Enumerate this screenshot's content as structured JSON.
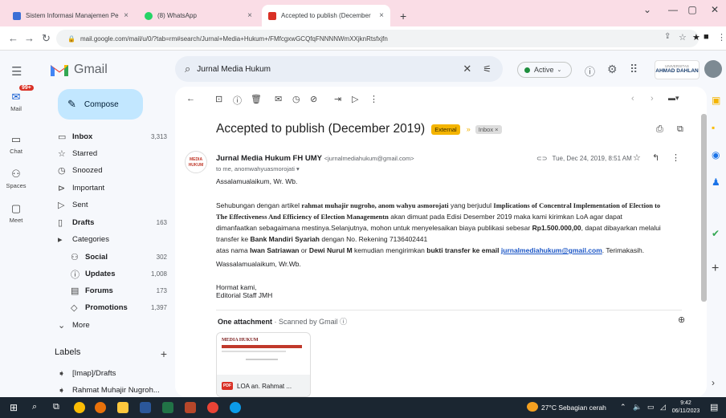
{
  "browser": {
    "tabs": [
      {
        "title": "Sistem Informasi Manajemen Pe",
        "close": "×",
        "color": "#3b6fd6"
      },
      {
        "title": "(8) WhatsApp",
        "close": "×",
        "color": "#25d366"
      },
      {
        "title": "Accepted to publish (December",
        "close": "×",
        "color": "#d93025"
      }
    ],
    "new_tab": "+",
    "window_controls": [
      "⌄",
      "—",
      "▢",
      "✕"
    ],
    "url": "mail.google.com/mail/u/0/?tab=rm#search/Jurnal+Media+Hukum+/FMfcgxwGCQfqFNNNNWmXXjknRtsfxjfn"
  },
  "header": {
    "brand": "Gmail",
    "search_value": "Jurnal Media Hukum",
    "status": "Active",
    "account_label": "AHMAD DAHLAN",
    "account_sub": "UNIVERSITAS"
  },
  "rail": {
    "items": [
      {
        "label": "Mail",
        "badge": "99+"
      },
      {
        "label": "Chat"
      },
      {
        "label": "Spaces"
      },
      {
        "label": "Meet"
      }
    ]
  },
  "sidebar": {
    "compose": "Compose",
    "items": [
      {
        "label": "Inbox",
        "count": "3,313",
        "icon": "▭",
        "bold": true
      },
      {
        "label": "Starred",
        "count": "",
        "icon": "☆",
        "bold": false
      },
      {
        "label": "Snoozed",
        "count": "",
        "icon": "◷",
        "bold": false
      },
      {
        "label": "Important",
        "count": "",
        "icon": "⊳",
        "bold": false
      },
      {
        "label": "Sent",
        "count": "",
        "icon": "▷",
        "bold": false
      },
      {
        "label": "Drafts",
        "count": "163",
        "icon": "▯",
        "bold": true
      },
      {
        "label": "Categories",
        "count": "",
        "icon": "▸",
        "bold": false
      },
      {
        "label": "Social",
        "count": "302",
        "icon": "⚇",
        "bold": true,
        "sub": true
      },
      {
        "label": "Updates",
        "count": "1,008",
        "icon": "ⓘ",
        "bold": true,
        "sub": true
      },
      {
        "label": "Forums",
        "count": "173",
        "icon": "▤",
        "bold": true,
        "sub": true
      },
      {
        "label": "Promotions",
        "count": "1,397",
        "icon": "◇",
        "bold": true,
        "sub": true
      },
      {
        "label": "More",
        "count": "",
        "icon": "⌄",
        "bold": false
      }
    ],
    "labels_title": "Labels",
    "labels_add": "+",
    "labels": [
      {
        "label": "[Imap]/Drafts"
      },
      {
        "label": "Rahmat Muhajir Nugroh..."
      }
    ]
  },
  "email": {
    "subject": "Accepted to publish (December 2019)",
    "tag_external": "External",
    "tag_inbox": "Inbox ×",
    "sender_name": "Jurnal Media Hukum FH UMY",
    "sender_email": "<jurnalmediahukum@gmail.com>",
    "to_line": "to me, anomwahyuasmorojati ▾",
    "date": "Tue, Dec 24, 2019, 8:51 AM",
    "avatar_text": "MEDIA HUKUM",
    "greeting": "Assalamualaikum, Wr. Wb.",
    "para1_a": "Sehubungan dengan artikel",
    "para1_b": "rahmat muhajir nugroho, anom wahyu asmorojati",
    "para1_c": "yang berjudul",
    "para1_d": "Implications of Concentral Implementation of Election to The Effectiveness And Efficiency of Election Managementn",
    "para1_e": "akan dimuat pada Edisi Desember 2019 maka kami kirimkan LoA agar dapat dimanfaatkan sebagaimana mestinya.Selanjutnya, mohon untuk menyelesaikan biaya publikasi sebesar",
    "para1_f": "Rp1.500.000,00",
    "para1_g": ", dapat dibayarkan melalui transfer ke",
    "para1_h": "Bank Mandiri Syariah",
    "para1_i": "dengan No. Rekening 7136402441",
    "para2_a": "atas nama",
    "para2_b": "Iwan Satriawan",
    "para2_c": "or",
    "para2_d": "Dewi Nurul M",
    "para2_e": "kemudian mengirimkan",
    "para2_f": "bukti transfer ke email",
    "para2_g": "jurnalmediahukum@gmail.com",
    "para2_h": ". Terimakasih.",
    "closing": "Wassalamualaikum, Wr.Wb.",
    "sign1": "Hormat kami,",
    "sign2": "Editorial Staff JMH",
    "attach_title": "One attachment",
    "attach_scan": "· Scanned by Gmail ⓘ",
    "attach_name": "LOA an. Rahmat ...",
    "attach_thumb_title": "MEDIA HUKUM"
  },
  "taskbar": {
    "weather": "27°C  Sebagian cerah",
    "time": "9:42",
    "date": "06/11/2023"
  },
  "colors": {
    "accent": "#0b57d0",
    "compose": "#c2e7ff",
    "external": "#f4b400"
  }
}
